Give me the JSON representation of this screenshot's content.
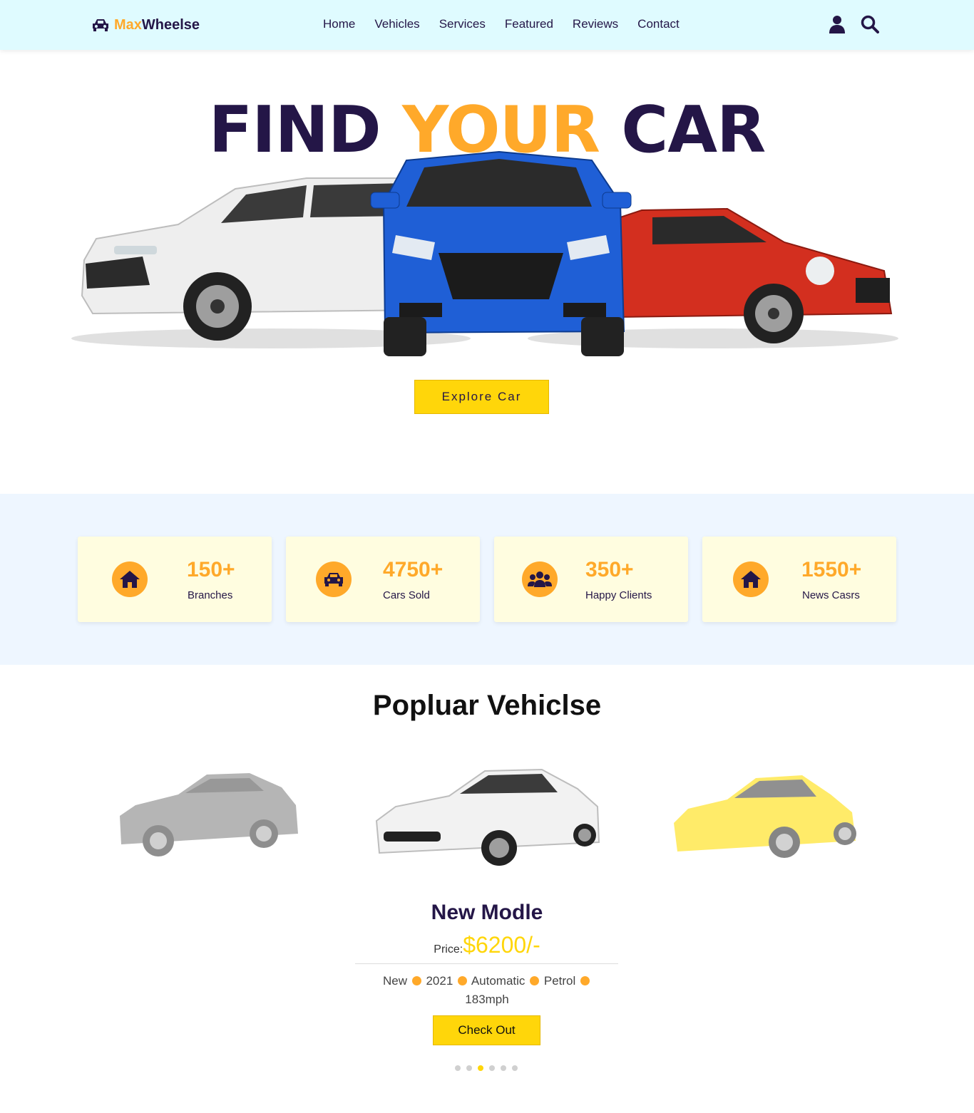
{
  "header": {
    "logo_max": "Max",
    "logo_wheelse": "Wheelse",
    "nav": [
      "Home",
      "Vehicles",
      "Services",
      "Featured",
      "Reviews",
      "Contact"
    ]
  },
  "hero": {
    "title_1": "FIND",
    "title_2": "YOUR",
    "title_3": "CAR",
    "cta": "Explore Car"
  },
  "stats": [
    {
      "icon": "home-icon",
      "value": "150+",
      "label": "Branches"
    },
    {
      "icon": "car-icon",
      "value": "4750+",
      "label": "Cars Sold"
    },
    {
      "icon": "users-icon",
      "value": "350+",
      "label": "Happy Clients"
    },
    {
      "icon": "home-icon",
      "value": "1550+",
      "label": "News Casrs"
    }
  ],
  "popular": {
    "title_1": "Popluar",
    "title_2": "Vehiclse",
    "model": "New Modle",
    "price_label": "Price:",
    "price_value": "$6200/-",
    "specs": [
      "New",
      "2021",
      "Automatic",
      "Petrol",
      "183mph"
    ],
    "cta": "Check Out",
    "slides": 6,
    "active_slide": 3
  },
  "colors": {
    "accent": "#ffa92a",
    "brand_dark": "#241647",
    "yellow": "#ffd60a",
    "header_bg": "#dffbff"
  }
}
